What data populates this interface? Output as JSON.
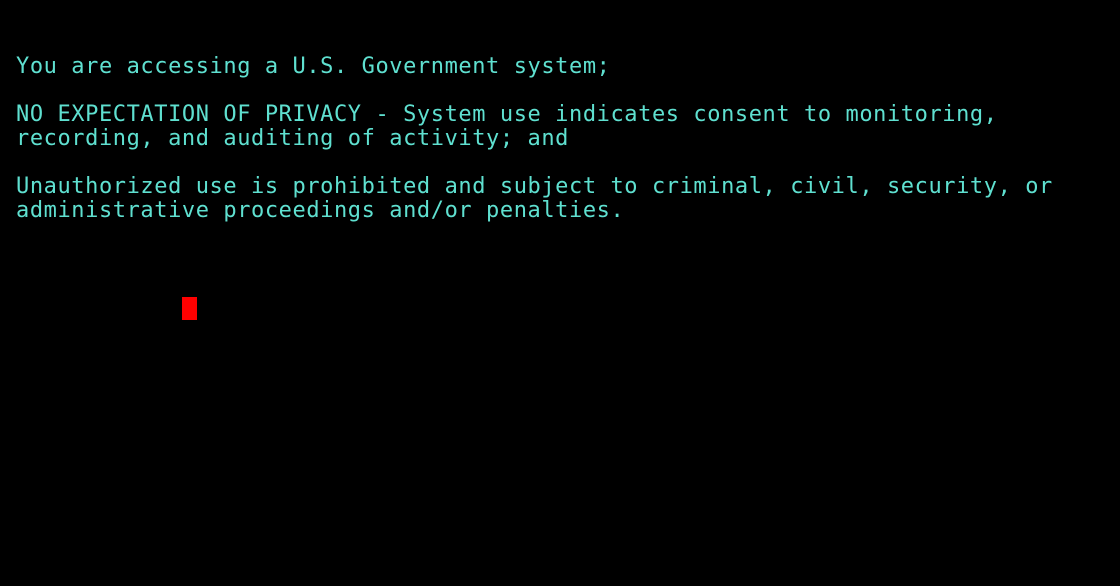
{
  "terminal": {
    "lines": [
      "You are accessing a U.S. Government system;",
      "NO EXPECTATION OF PRIVACY - System use indicates consent to monitoring,",
      "recording, and auditing of activity; and",
      "Unauthorized use is prohibited and subject to criminal, civil, security, or",
      "administrative proceedings and/or penalties."
    ]
  },
  "colors": {
    "background": "#000000",
    "text": "#5fe0d0",
    "cursor": "#ff0000"
  }
}
